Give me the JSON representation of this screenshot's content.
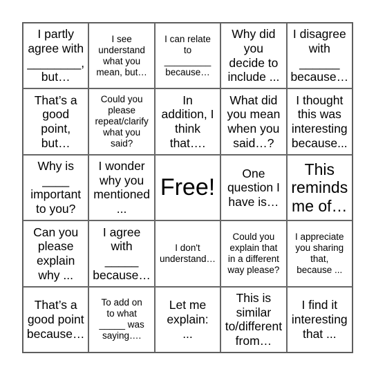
{
  "cells": [
    {
      "text": "I partly\nagree with\n________,\nbut…",
      "size": "m"
    },
    {
      "text": "I see\nunderstand\nwhat you\nmean, but…",
      "size": "s"
    },
    {
      "text": "I can relate\nto\n_________\nbecause…",
      "size": "s"
    },
    {
      "text": "Why did\nyou\ndecide to\ninclude ...",
      "size": "m"
    },
    {
      "text": "I disagree\nwith\n______\nbecause…",
      "size": "m"
    },
    {
      "text": "That’s a\ngood\npoint,\nbut…",
      "size": "m"
    },
    {
      "text": "Could you\nplease\nrepeat/clarify\nwhat you\nsaid?",
      "size": "s"
    },
    {
      "text": "In\naddition, I\nthink\nthat….",
      "size": "m"
    },
    {
      "text": "What did\nyou mean\nwhen you\nsaid…?",
      "size": "m"
    },
    {
      "text": "I thought\nthis was\ninteresting\nbecause...",
      "size": "m"
    },
    {
      "text": "Why is\n____\nimportant\nto you?",
      "size": "m"
    },
    {
      "text": "I wonder\nwhy you\nmentioned\n...",
      "size": "m"
    },
    {
      "text": "Free!",
      "size": "xl"
    },
    {
      "text": "One\nquestion I\nhave is…",
      "size": "m"
    },
    {
      "text": "This\nreminds\nme of…",
      "size": "l"
    },
    {
      "text": "Can you\nplease\nexplain\nwhy ...",
      "size": "m"
    },
    {
      "text": "I agree\nwith\n_____\nbecause…",
      "size": "m"
    },
    {
      "text": "I don't\nunderstand…",
      "size": "s"
    },
    {
      "text": "Could you\nexplain that\nin a different\nway please?",
      "size": "s"
    },
    {
      "text": "I appreciate\nyou sharing\nthat,\nbecause ...",
      "size": "s"
    },
    {
      "text": "That’s a\ngood point\nbecause…",
      "size": "m"
    },
    {
      "text": "To add on\nto what\n_____ was\nsaying….",
      "size": "s"
    },
    {
      "text": "Let me\nexplain:\n...",
      "size": "m"
    },
    {
      "text": "This is\nsimilar\nto/different\nfrom…",
      "size": "m"
    },
    {
      "text": "I find it\ninteresting\nthat ...",
      "size": "m"
    }
  ]
}
